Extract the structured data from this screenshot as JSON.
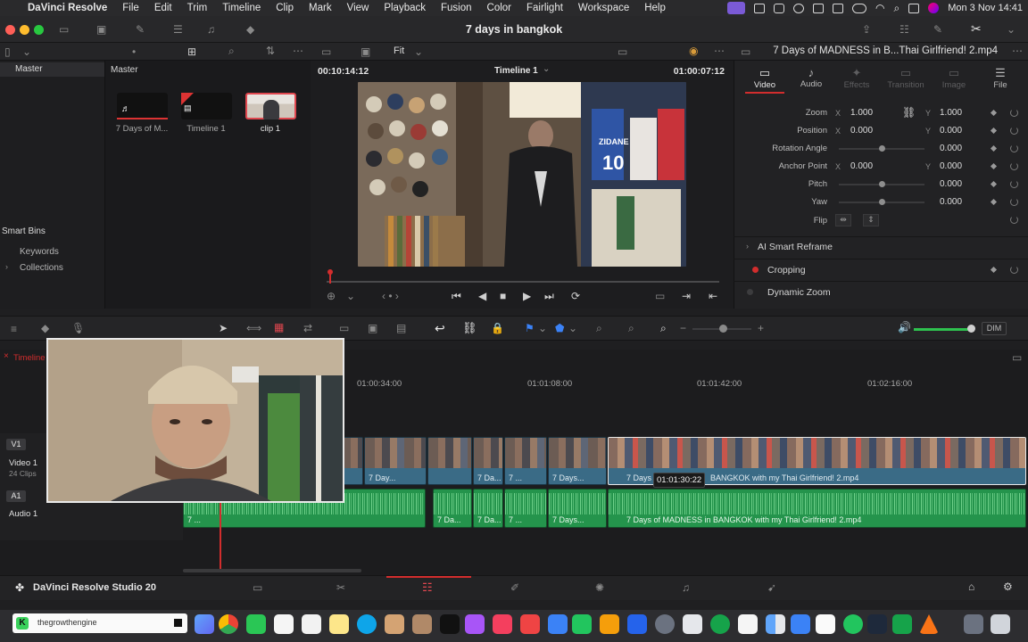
{
  "menubar": {
    "app_name": "DaVinci Resolve",
    "items": [
      "File",
      "Edit",
      "Trim",
      "Timeline",
      "Clip",
      "Mark",
      "View",
      "Playback",
      "Fusion",
      "Color",
      "Fairlight",
      "Workspace",
      "Help"
    ],
    "clock": "Mon 3 Nov  14:41"
  },
  "window": {
    "project_title": "7 days in bangkok"
  },
  "toolbar": {
    "zoom_label": "Fit",
    "inspector_clip_title": "7 Days of MADNESS in B...Thai Girlfriend! 2.mp4"
  },
  "media_pool": {
    "bin_title": "Master",
    "pool_title": "Master",
    "smart_bins": "Smart Bins",
    "smart_bin_items": [
      "Keywords",
      "Collections"
    ],
    "clips": [
      {
        "label": "7 Days of M...",
        "type": "audio"
      },
      {
        "label": "Timeline 1",
        "type": "timeline"
      },
      {
        "label": "clip 1",
        "type": "video"
      }
    ]
  },
  "viewer": {
    "source_timecode": "00:10:14:12",
    "timeline_name": "Timeline 1",
    "record_timecode": "01:00:07:12"
  },
  "inspector": {
    "tabs": [
      "Video",
      "Audio",
      "Effects",
      "Transition",
      "Image",
      "File"
    ],
    "zoom": {
      "label": "Zoom",
      "x": "1.000",
      "y": "1.000"
    },
    "position": {
      "label": "Position",
      "x": "0.000",
      "y": "0.000"
    },
    "rotation": {
      "label": "Rotation Angle",
      "value": "0.000"
    },
    "anchor": {
      "label": "Anchor Point",
      "x": "0.000",
      "y": "0.000"
    },
    "pitch": {
      "label": "Pitch",
      "value": "0.000"
    },
    "yaw": {
      "label": "Yaw",
      "value": "0.000"
    },
    "flip": {
      "label": "Flip"
    },
    "axis_x": "X",
    "axis_y": "Y",
    "sections": [
      "AI Smart Reframe",
      "Cropping",
      "Dynamic Zoom"
    ]
  },
  "audio": {
    "dim_label": "DIM"
  },
  "timeline": {
    "tab_label": "Timeline",
    "ruler": [
      "01:00:34:00",
      "01:01:08:00",
      "01:01:42:00",
      "01:02:16:00"
    ],
    "tracks": {
      "v1": {
        "id": "V1",
        "name": "Video 1",
        "info": "24 Clips"
      },
      "a1": {
        "id": "A1",
        "name": "Audio 1"
      }
    },
    "hover_timecode": "01:01:30:22",
    "clip_names": {
      "short1": "7 Day...",
      "short2": "7 Da...",
      "short3": "7 ...",
      "short4": "7 Days...",
      "video_long": "BANGKOK with my Thai Girlfriend! 2.mp4",
      "video_long_prefix": "7 Days",
      "audio_long": "7 Days of MADNESS in BANGKOK with my Thai Girlfriend! 2.mp4"
    }
  },
  "pages": {
    "product": "DaVinci Resolve Studio 20"
  },
  "dock": {
    "tooltip_label": "thegrowthengine"
  },
  "colors": {
    "accent_red": "#d22d2d",
    "video_clip": "#3a6b86",
    "audio_clip": "#24944c"
  }
}
